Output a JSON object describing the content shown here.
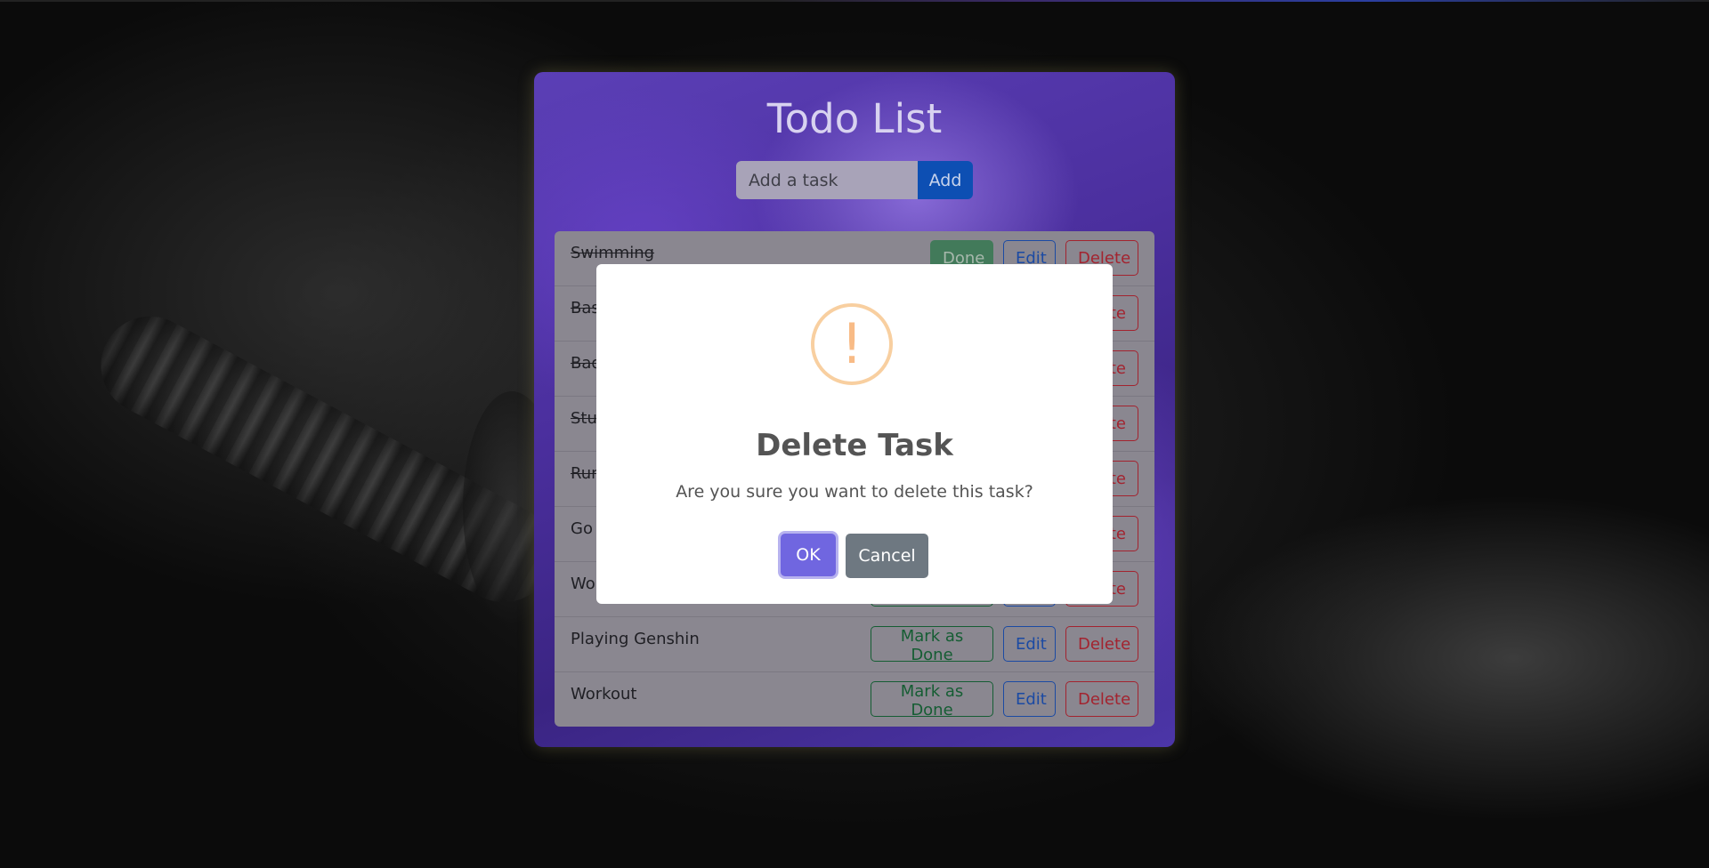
{
  "app": {
    "title": "Todo List",
    "input_placeholder": "Add a task",
    "add_label": "Add"
  },
  "tasks": [
    {
      "text": "Swimming",
      "done": true,
      "done_label": "Done",
      "edit_label": "Edit",
      "delete_label": "Delete"
    },
    {
      "text": "Bas",
      "done": true,
      "done_label": "",
      "edit_label": "",
      "delete_label": "te"
    },
    {
      "text": "Bad",
      "done": true,
      "done_label": "",
      "edit_label": "",
      "delete_label": "te"
    },
    {
      "text": "Stu",
      "done": true,
      "done_label": "",
      "edit_label": "",
      "delete_label": "te"
    },
    {
      "text": "Run",
      "done": true,
      "done_label": "",
      "edit_label": "",
      "delete_label": "te"
    },
    {
      "text": "Go",
      "done": false,
      "done_label": "",
      "edit_label": "",
      "delete_label": "te"
    },
    {
      "text": "Wo",
      "done": false,
      "done_label": "",
      "edit_label": "",
      "delete_label": "te"
    },
    {
      "text": "Playing Genshin",
      "done": false,
      "done_label": "Mark as Done",
      "edit_label": "Edit",
      "delete_label": "Delete"
    },
    {
      "text": "Workout",
      "done": false,
      "done_label": "Mark as Done",
      "edit_label": "Edit",
      "delete_label": "Delete"
    }
  ],
  "modal": {
    "icon": "!",
    "icon_name": "warning-icon",
    "title": "Delete Task",
    "text": "Are you sure you want to delete this task?",
    "ok_label": "OK",
    "cancel_label": "Cancel"
  }
}
